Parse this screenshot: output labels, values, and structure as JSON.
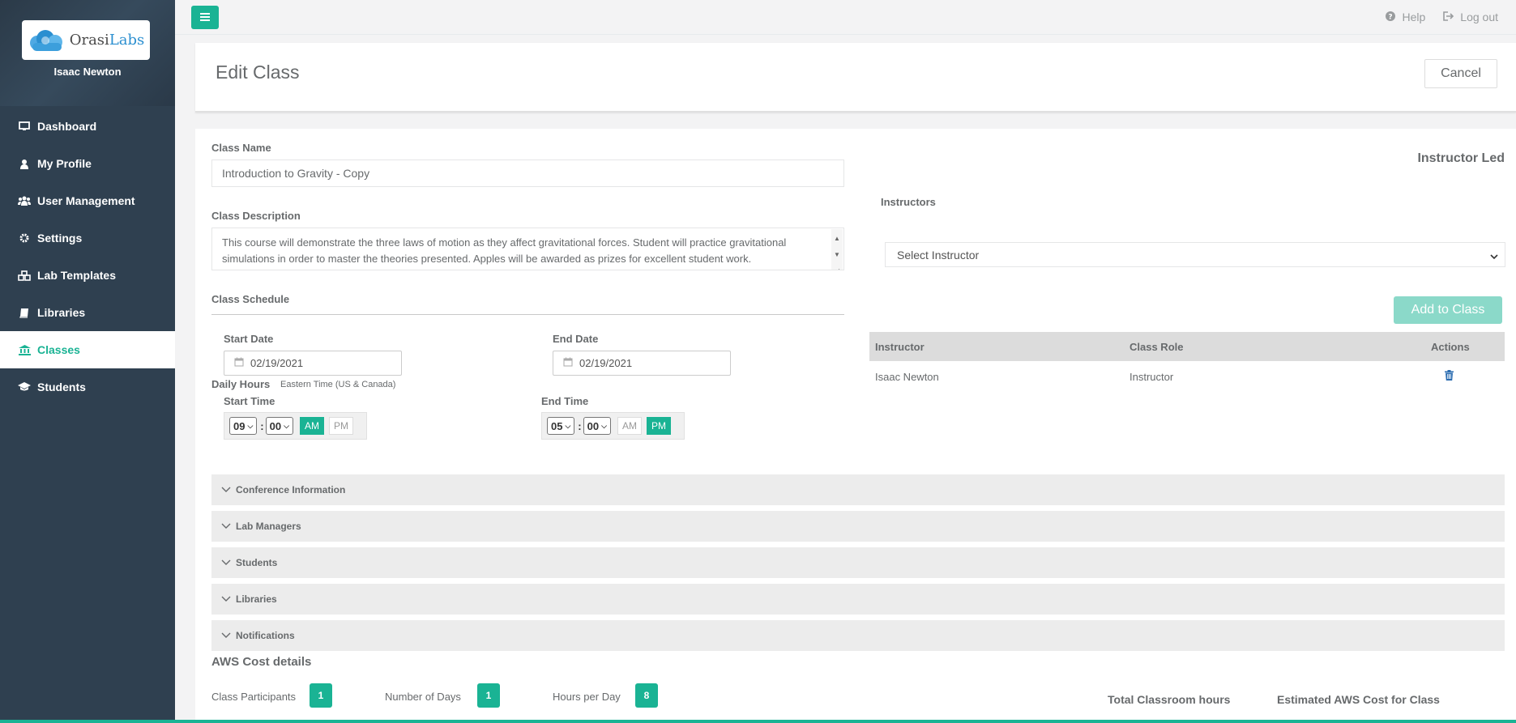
{
  "brand": {
    "logo_prefix": "Orasi",
    "logo_suffix": "Labs",
    "user_name": "Isaac Newton"
  },
  "sidebar": {
    "items": [
      {
        "label": "Dashboard",
        "icon": "monitor-icon"
      },
      {
        "label": "My Profile",
        "icon": "user-icon"
      },
      {
        "label": "User Management",
        "icon": "users-icon"
      },
      {
        "label": "Settings",
        "icon": "gear-icon"
      },
      {
        "label": "Lab Templates",
        "icon": "cubes-icon"
      },
      {
        "label": "Libraries",
        "icon": "book-icon"
      },
      {
        "label": "Classes",
        "icon": "bank-icon",
        "active": true
      },
      {
        "label": "Students",
        "icon": "graduation-cap-icon"
      }
    ]
  },
  "topbar": {
    "help": "Help",
    "logout": "Log out"
  },
  "header": {
    "title": "Edit Class",
    "cancel": "Cancel"
  },
  "form": {
    "class_name_label": "Class Name",
    "class_name_value": "Introduction to Gravity - Copy",
    "class_desc_label": "Class Description",
    "class_desc_value": "This course will demonstrate the three laws of motion as they affect gravitational forces.  Student will practice gravitational simulations in order to master the theories presented.  Apples will be awarded as prizes for excellent student work.",
    "schedule_label": "Class Schedule",
    "start_date_label": "Start Date",
    "start_date_value": "02/19/2021",
    "end_date_label": "End Date",
    "end_date_value": "02/19/2021",
    "daily_hours_label": "Daily Hours",
    "timezone": "Eastern Time (US & Canada)",
    "start_time_label": "Start Time",
    "start_hour": "09",
    "start_min": "00",
    "end_time_label": "End Time",
    "end_hour": "05",
    "end_min": "00",
    "am": "AM",
    "pm": "PM"
  },
  "instructors": {
    "mode": "Instructor Led",
    "label": "Instructors",
    "select_placeholder": "Select Instructor",
    "add_button": "Add to Class",
    "columns": [
      "Instructor",
      "Class Role",
      "Actions"
    ],
    "rows": [
      {
        "instructor": "Isaac Newton",
        "role": "Instructor"
      }
    ]
  },
  "sections": [
    "Conference Information",
    "Lab Managers",
    "Students",
    "Libraries",
    "Notifications"
  ],
  "aws": {
    "title": "AWS Cost details",
    "participants_label": "Class Participants",
    "participants": "1",
    "days_label": "Number of Days",
    "days": "1",
    "hours_label": "Hours per Day",
    "hours": "8",
    "total_hours_label": "Total Classroom hours",
    "est_cost_label": "Estimated AWS Cost for Class"
  },
  "colors": {
    "accent": "#1ab394",
    "sidebar": "#2f4050"
  }
}
